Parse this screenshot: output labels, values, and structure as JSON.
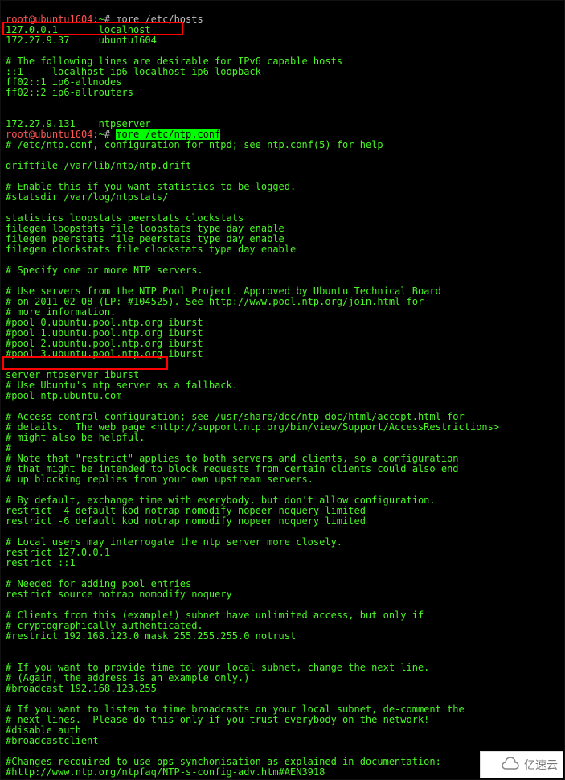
{
  "prompt1": {
    "user": "root",
    "host": "ubuntu1604",
    "path": "~",
    "symbol": "#",
    "command": "more /etc/hosts"
  },
  "hosts_file": {
    "l1": "127.0.0.1       localhost",
    "l2": "172.27.9.37     ubuntu1604",
    "l3": "",
    "l4": "# The following lines are desirable for IPv6 capable hosts",
    "l5": "::1     localhost ip6-localhost ip6-loopback",
    "l6": "ff02::1 ip6-allnodes",
    "l7": "ff02::2 ip6-allrouters",
    "l8": "",
    "l9": "",
    "l10": "172.27.9.131    ntpserver"
  },
  "prompt2": {
    "user": "root",
    "host": "ubuntu1604",
    "path": "~",
    "symbol": "#",
    "command": "more /etc/ntp.conf"
  },
  "ntp_conf": {
    "l1": "# /etc/ntp.conf, configuration for ntpd; see ntp.conf(5) for help",
    "l2": "",
    "l3": "driftfile /var/lib/ntp/ntp.drift",
    "l4": "",
    "l5": "# Enable this if you want statistics to be logged.",
    "l6": "#statsdir /var/log/ntpstats/",
    "l7": "",
    "l8": "statistics loopstats peerstats clockstats",
    "l9": "filegen loopstats file loopstats type day enable",
    "l10": "filegen peerstats file peerstats type day enable",
    "l11": "filegen clockstats file clockstats type day enable",
    "l12": "",
    "l13": "# Specify one or more NTP servers.",
    "l14": "",
    "l15": "# Use servers from the NTP Pool Project. Approved by Ubuntu Technical Board",
    "l16": "# on 2011-02-08 (LP: #104525). See http://www.pool.ntp.org/join.html for",
    "l17": "# more information.",
    "l18": "#pool 0.ubuntu.pool.ntp.org iburst",
    "l19": "#pool 1.ubuntu.pool.ntp.org iburst",
    "l20": "#pool 2.ubuntu.pool.ntp.org iburst",
    "l21": "#pool 3.ubuntu.pool.ntp.org iburst",
    "l22": "",
    "l23": "server ntpserver iburst",
    "l24": "# Use Ubuntu's ntp server as a fallback.",
    "l25": "#pool ntp.ubuntu.com",
    "l26": "",
    "l27": "# Access control configuration; see /usr/share/doc/ntp-doc/html/accopt.html for",
    "l28": "# details.  The web page <http://support.ntp.org/bin/view/Support/AccessRestrictions>",
    "l29": "# might also be helpful.",
    "l30": "#",
    "l31": "# Note that \"restrict\" applies to both servers and clients, so a configuration",
    "l32": "# that might be intended to block requests from certain clients could also end",
    "l33": "# up blocking replies from your own upstream servers.",
    "l34": "",
    "l35": "# By default, exchange time with everybody, but don't allow configuration.",
    "l36": "restrict -4 default kod notrap nomodify nopeer noquery limited",
    "l37": "restrict -6 default kod notrap nomodify nopeer noquery limited",
    "l38": "",
    "l39": "# Local users may interrogate the ntp server more closely.",
    "l40": "restrict 127.0.0.1",
    "l41": "restrict ::1",
    "l42": "",
    "l43": "# Needed for adding pool entries",
    "l44": "restrict source notrap nomodify noquery",
    "l45": "",
    "l46": "# Clients from this (example!) subnet have unlimited access, but only if",
    "l47": "# cryptographically authenticated.",
    "l48": "#restrict 192.168.123.0 mask 255.255.255.0 notrust",
    "l49": "",
    "l50": "",
    "l51": "# If you want to provide time to your local subnet, change the next line.",
    "l52": "# (Again, the address is an example only.)",
    "l53": "#broadcast 192.168.123.255",
    "l54": "",
    "l55": "# If you want to listen to time broadcasts on your local subnet, de-comment the",
    "l56": "# next lines.  Please do this only if you trust everybody on the network!",
    "l57": "#disable auth",
    "l58": "#broadcastclient",
    "l59": "",
    "l60": "#Changes recquired to use pps synchonisation as explained in documentation:",
    "l61": "#http://www.ntp.org/ntpfaq/NTP-s-config-adv.htm#AEN3918"
  },
  "watermark": {
    "text": "亿速云"
  }
}
